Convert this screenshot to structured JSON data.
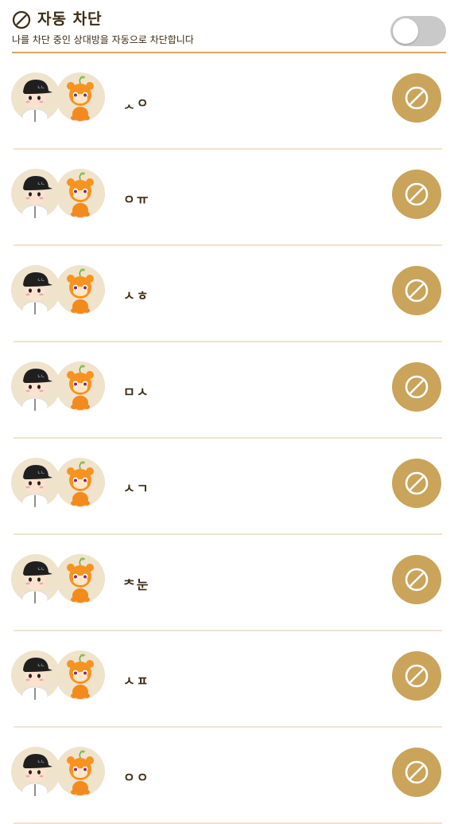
{
  "header": {
    "title": "자동 차단",
    "subtitle": "나를 차단 중인 상대방을 자동으로 차단합니다",
    "toggle_on": false
  },
  "users": [
    {
      "name": "ᆺㅇ"
    },
    {
      "name": "ㅇㅠ"
    },
    {
      "name": "ㅅㅎ"
    },
    {
      "name": "ㅁㅅ"
    },
    {
      "name": "ㅅㄱ"
    },
    {
      "name": "ᄎ눈"
    },
    {
      "name": "ㅅㅍ"
    },
    {
      "name": "ㅇㅇ"
    }
  ],
  "icons": {
    "header": "block-icon",
    "row_button": "block-icon"
  },
  "colors": {
    "accent": "#c9a45a",
    "divider": "#d4a95d",
    "text": "#3b2a12",
    "avatar_bg": "#efe3cc",
    "toggle_off": "#c9c9c9"
  }
}
